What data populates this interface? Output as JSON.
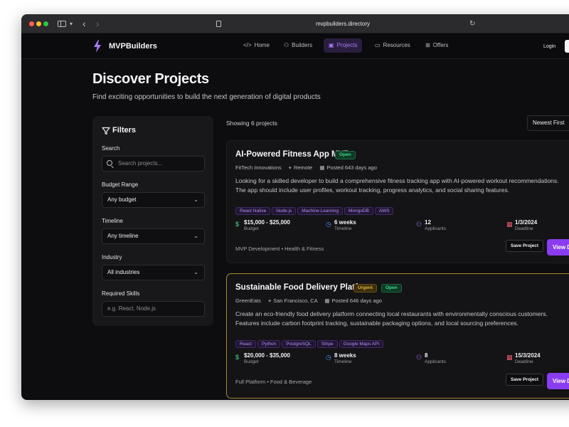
{
  "browser": {
    "url": "mvpbuilders.directory"
  },
  "nav": {
    "brand": "MVPBuilders",
    "links": [
      {
        "label": "Home",
        "icon": "code-icon"
      },
      {
        "label": "Builders",
        "icon": "users-icon"
      },
      {
        "label": "Projects",
        "icon": "briefcase-icon",
        "active": true
      },
      {
        "label": "Resources",
        "icon": "book-icon"
      },
      {
        "label": "Offers",
        "icon": "gift-icon"
      }
    ],
    "login": "Login"
  },
  "header": {
    "title": "Discover Projects",
    "subtitle": "Find exciting opportunities to build the next generation of digital products"
  },
  "filters": {
    "title": "Filters",
    "search_label": "Search",
    "search_placeholder": "Search projects...",
    "budget_label": "Budget Range",
    "budget_value": "Any budget",
    "timeline_label": "Timeline",
    "timeline_value": "Any timeline",
    "industry_label": "Industry",
    "industry_value": "All industries",
    "skills_label": "Required Skills",
    "skills_placeholder": "e.g. React, Node.js"
  },
  "results": {
    "count_text": "Showing 6 projects",
    "sort_value": "Newest First"
  },
  "projects": [
    {
      "title": "AI-Powered Fitness App MVP",
      "badges": [
        "Open"
      ],
      "company": "FitTech Innovations",
      "location": "Remote",
      "posted": "Posted 643 days ago",
      "description_1": "Looking for a skilled developer to build a comprehensive fitness tracking app with AI-powered workout recommendations.",
      "description_2": "The app should include user profiles, workout tracking, progress analytics, and social sharing features.",
      "tags": [
        "React Native",
        "Node.js",
        "Machine Learning",
        "MongoDB",
        "AWS"
      ],
      "budget": "$15,000 - $25,000",
      "budget_label": "Budget",
      "timeline": "6 weeks",
      "timeline_label": "Timeline",
      "applicants": "12",
      "applicants_label": "Applicants",
      "deadline": "1/3/2024",
      "deadline_label": "Deadline",
      "category": "MVP Development • Health & Fitness",
      "save_label": "Save Project",
      "view_label": "View Details"
    },
    {
      "title": "Sustainable Food Delivery Platform",
      "badges": [
        "Urgent",
        "Open"
      ],
      "company": "GreenEats",
      "location": "San Francisco, CA",
      "posted": "Posted 646 days ago",
      "description_1": "Create an eco-friendly food delivery platform connecting local restaurants with environmentally conscious customers.",
      "description_2": "Features include carbon footprint tracking, sustainable packaging options, and local sourcing preferences.",
      "tags": [
        "React",
        "Python",
        "PostgreSQL",
        "Stripe",
        "Google Maps API"
      ],
      "budget": "$20,000 - $35,000",
      "budget_label": "Budget",
      "timeline": "8 weeks",
      "timeline_label": "Timeline",
      "applicants": "8",
      "applicants_label": "Applicants",
      "deadline": "15/3/2024",
      "deadline_label": "Deadline",
      "category": "Full Platform • Food & Beverage",
      "save_label": "Save Project",
      "view_label": "View Details"
    }
  ],
  "colors": {
    "accent": "#8a3df0",
    "open_badge": "#3ddc84",
    "urgent_badge": "#e0b43a",
    "budget_icon": "#3ddc84",
    "timeline_icon": "#4a8ff5",
    "applicants_icon": "#a978f5",
    "deadline_icon": "#f05a6e"
  }
}
